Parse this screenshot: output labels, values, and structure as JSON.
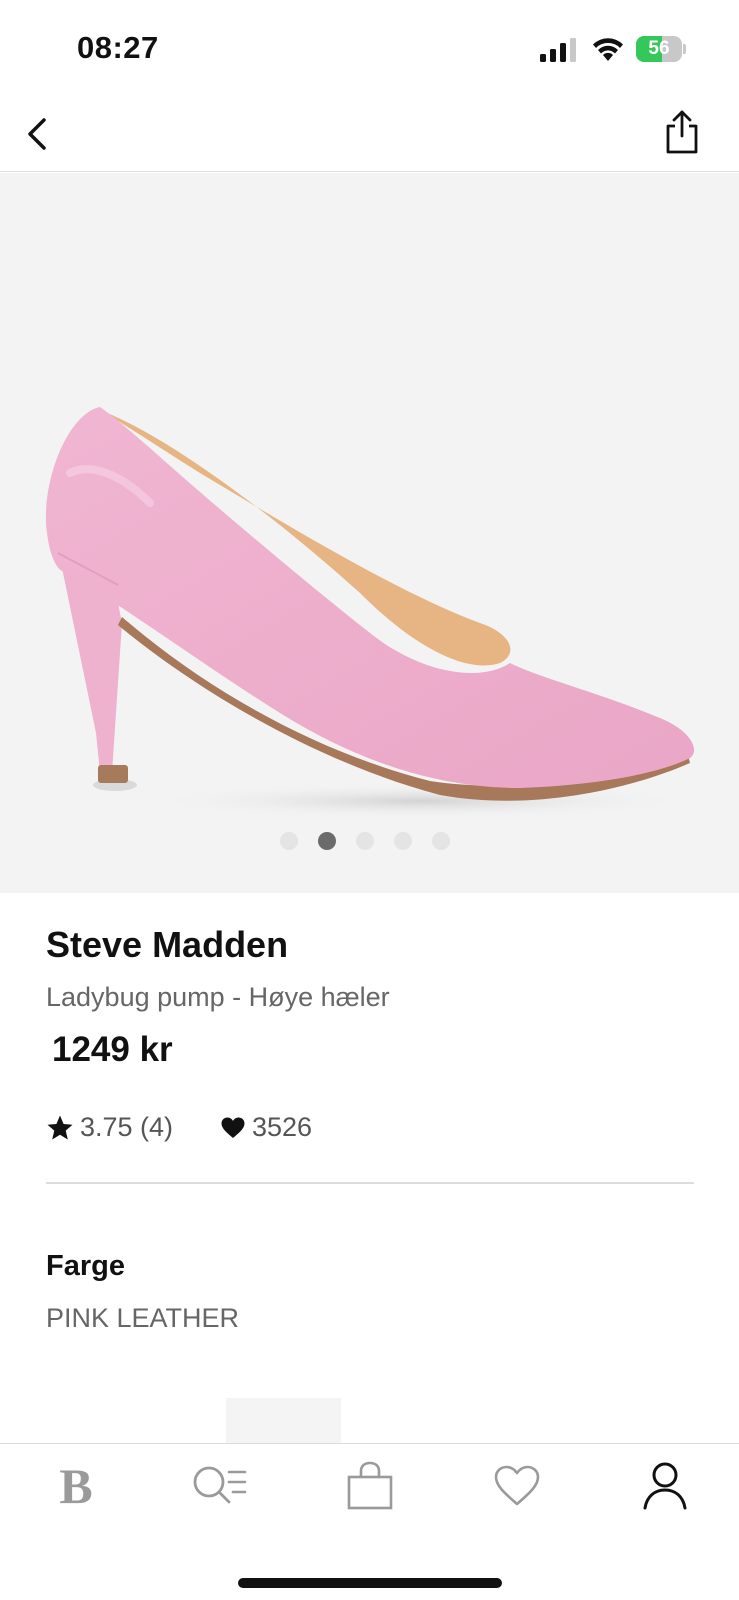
{
  "status_bar": {
    "time": "08:27",
    "battery_level": "56",
    "battery_fraction": 0.56,
    "battery_color": "#34c759"
  },
  "nav": {
    "back_icon": "chevron-left-icon",
    "share_icon": "share-icon"
  },
  "gallery": {
    "image_count": 5,
    "active_index": 1,
    "favorite_icon": "heart-outline-icon"
  },
  "product": {
    "brand": "Steve Madden",
    "name": "Ladybug pump - Høye hæler",
    "price": "1249 kr",
    "rating": "3.75 (4)",
    "likes": "3526",
    "color_label": "Farge",
    "color_value": "PINK LEATHER"
  },
  "tab_bar": {
    "items": [
      {
        "name": "home",
        "label": "B",
        "icon": "brand-logo-icon",
        "active": false
      },
      {
        "name": "search",
        "icon": "search-list-icon",
        "active": false
      },
      {
        "name": "bag",
        "icon": "shopping-bag-icon",
        "active": false
      },
      {
        "name": "wishlist",
        "icon": "heart-outline-icon",
        "active": false
      },
      {
        "name": "profile",
        "icon": "person-icon",
        "active": true
      }
    ]
  }
}
